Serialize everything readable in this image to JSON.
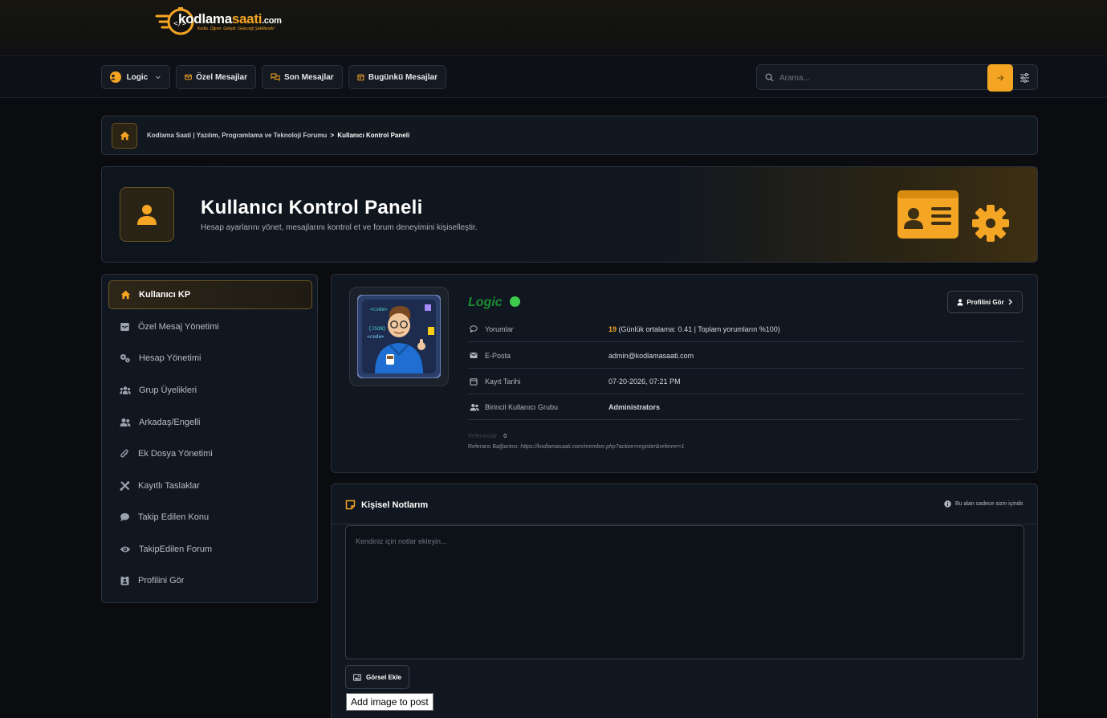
{
  "logo": {
    "part1": "kodlama",
    "part2": "saati",
    "part3": ".com",
    "tagline": "Kodla. Öğren. Geliştir. Geleceği Şekillendir!"
  },
  "nav": {
    "user_label": "Logic",
    "pm_label": "Özel Mesajlar",
    "recent_label": "Son Mesajlar",
    "today_label": "Bugünkü Mesajlar",
    "search_placeholder": "Arama..."
  },
  "breadcrumb": {
    "forum": "Kodlama Saati | Yazılım, Programlama ve Teknoloji Forumu",
    "separator": ">",
    "current": "Kullanıcı Kontrol Paneli"
  },
  "hero": {
    "title": "Kullanıcı Kontrol Paneli",
    "subtitle": "Hesap ayarlarını yönet, mesajlarını kontrol et ve forum deneyimini kişiselleştir."
  },
  "sidebar": {
    "items": [
      {
        "label": "Kullanıcı KP",
        "icon": "home-icon",
        "active": true
      },
      {
        "label": "Özel Mesaj Yönetimi",
        "icon": "inbox-icon"
      },
      {
        "label": "Hesap Yönetimi",
        "icon": "gears-icon"
      },
      {
        "label": "Grup Üyelikleri",
        "icon": "group-icon"
      },
      {
        "label": "Arkadaş/Engelli",
        "icon": "users-icon"
      },
      {
        "label": "Ek Dosya Yönetimi",
        "icon": "paperclip-icon"
      },
      {
        "label": "Kayıtlı Taslaklar",
        "icon": "tools-icon"
      },
      {
        "label": "Takip Edilen Konu",
        "icon": "comment-icon"
      },
      {
        "label": "TakipEdilen Forum",
        "icon": "eye-icon"
      },
      {
        "label": "Profilini Gör",
        "icon": "id-badge-icon"
      }
    ]
  },
  "profile": {
    "username": "Logic",
    "view_profile_label": "Profilini Gör",
    "posts_label": "Yorumlar",
    "posts_count": "19",
    "posts_extra": "(Günlük ortalama: 0.41 | Toplam yorumların %100)",
    "email_label": "E-Posta",
    "email_value": "admin@kodlamasaati.com",
    "regdate_label": "Kayıt Tarihi",
    "regdate_value": "07-20-2026, 07:21 PM",
    "group_label": "Birincil Kullanıcı Grubu",
    "group_value": "Administrators",
    "referrals_label": "Referanslar",
    "referrals_count": "0",
    "ref_link_label": "Referans Bağlantısı:",
    "ref_link_value": "https://kodlamasaati.com/member.php?action=register&referrer=1"
  },
  "notes": {
    "title": "Kişisel Notlarım",
    "info": "Bu alan sadece sizin içindir.",
    "placeholder": "Kendiniz için notlar ekleyin...",
    "add_image_label": "Görsel Ekle",
    "add_image_post_label": "Add image to post"
  },
  "colors": {
    "accent": "#f5a524",
    "online": "#3ecb4d",
    "username": "#1d8a32",
    "background": "#0b0c0f"
  }
}
